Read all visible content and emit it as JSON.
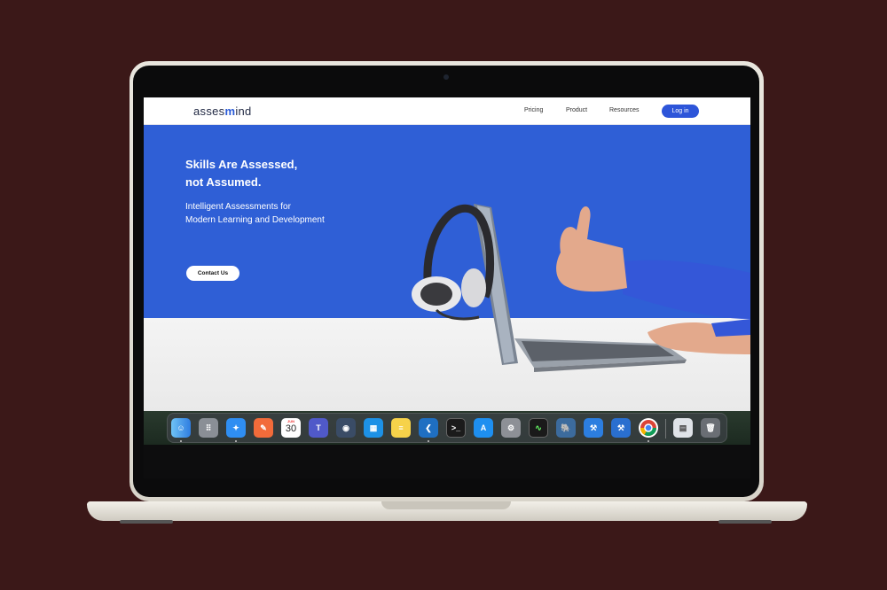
{
  "navbar": {
    "logo_prefix": "asses",
    "logo_accent": "m",
    "logo_suffix": "ind",
    "links": [
      "Pricing",
      "Product",
      "Resources"
    ],
    "login_label": "Log in"
  },
  "hero": {
    "title_line1": "Skills Are Assessed,",
    "title_line2": "not Assumed.",
    "subtitle_line1": "Intelligent Assessments for",
    "subtitle_line2": "Modern Learning and Development",
    "cta_label": "Contact Us"
  },
  "dock": {
    "calendar_month": "JUN",
    "calendar_day": "30",
    "apps": [
      "finder-icon",
      "launchpad-icon",
      "safari-icon",
      "postman-icon",
      "calendar-icon",
      "teams-icon",
      "eye-app-icon",
      "docker-icon",
      "notes-icon",
      "vscode-icon",
      "terminal-icon",
      "app-store-icon",
      "system-settings-icon",
      "activity-monitor-icon",
      "postgres-icon",
      "xcode-tools-icon",
      "xcode-icon",
      "chrome-icon",
      "preview-icon",
      "trash-icon"
    ]
  },
  "colors": {
    "hero_blue": "#2f5fd6",
    "button_blue": "#2d55d9",
    "background": "#3b1818"
  }
}
